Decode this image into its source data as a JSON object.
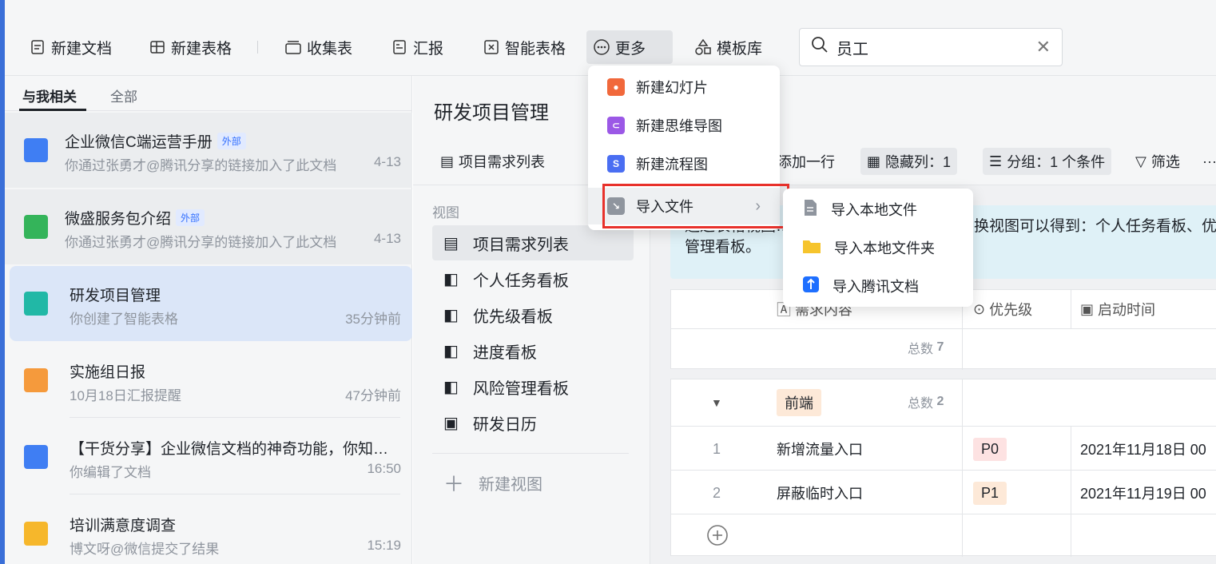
{
  "toolbar": {
    "new_doc": "新建文档",
    "new_sheet": "新建表格",
    "collect_form": "收集表",
    "report": "汇报",
    "smart_sheet": "智能表格",
    "more": "更多",
    "templates": "模板库",
    "search_value": "员工"
  },
  "sidebar": {
    "tabs": [
      "与我相关",
      "全部"
    ],
    "docs": [
      {
        "title": "企业微信C端运营手册",
        "badge": "外部",
        "sub": "你通过张勇才@腾讯分享的链接加入了此文档",
        "time": "4-13"
      },
      {
        "title": "微盛服务包介绍",
        "badge": "外部",
        "sub": "你通过张勇才@腾讯分享的链接加入了此文档",
        "time": "4-13"
      },
      {
        "title": "研发项目管理",
        "sub": "你创建了智能表格",
        "time": "35分钟前"
      },
      {
        "title": "实施组日报",
        "sub": "10月18日汇报提醒",
        "time": "47分钟前"
      },
      {
        "title": "【干货分享】企业微信文档的神奇功能，你知道几个？",
        "sub": "你编辑了文档",
        "time": "16:50"
      },
      {
        "title": "培训满意度调查",
        "sub": "博文呀@微信提交了结果",
        "time": "15:19"
      }
    ]
  },
  "main": {
    "title": "研发项目管理",
    "view_bar": {
      "current_view": "项目需求列表",
      "add_row": "添加一行",
      "hidden_cols": "隐藏列：1",
      "group": "分组：1 个条件",
      "filter": "筛选",
      "more": "···"
    },
    "views_label": "视图",
    "views": [
      "项目需求列表",
      "个人任务看板",
      "优先级看板",
      "进度看板",
      "风险管理看板",
      "研发日历"
    ],
    "new_view": "新建视图",
    "notice_line1": "通过表格视图…",
    "notice_line1_right": "换视图可以得到：个人任务看板、优",
    "notice_line2": "管理看板。",
    "table": {
      "headers": [
        "需求内容",
        "优先级",
        "启动时间"
      ],
      "total_label": "总数",
      "total": "7",
      "group_name": "前端",
      "group_total": "2",
      "rows": [
        {
          "idx": "1",
          "content": "新增流量入口",
          "priority": "P0",
          "start": "2021年11月18日 00"
        },
        {
          "idx": "2",
          "content": "屏蔽临时入口",
          "priority": "P1",
          "start": "2021年11月19日 00"
        }
      ]
    }
  },
  "more_menu": {
    "items": [
      "新建幻灯片",
      "新建思维导图",
      "新建流程图",
      "导入文件"
    ]
  },
  "import_submenu": {
    "items": [
      "导入本地文件",
      "导入本地文件夹",
      "导入腾讯文档"
    ]
  },
  "colors": {
    "accent": "#3a6fd8",
    "highlight_border": "#e8312b",
    "selected_row": "#dbe6f8",
    "notice_bg": "#dff1f7",
    "p0": "#fde2e2",
    "p1": "#fde9d8"
  }
}
